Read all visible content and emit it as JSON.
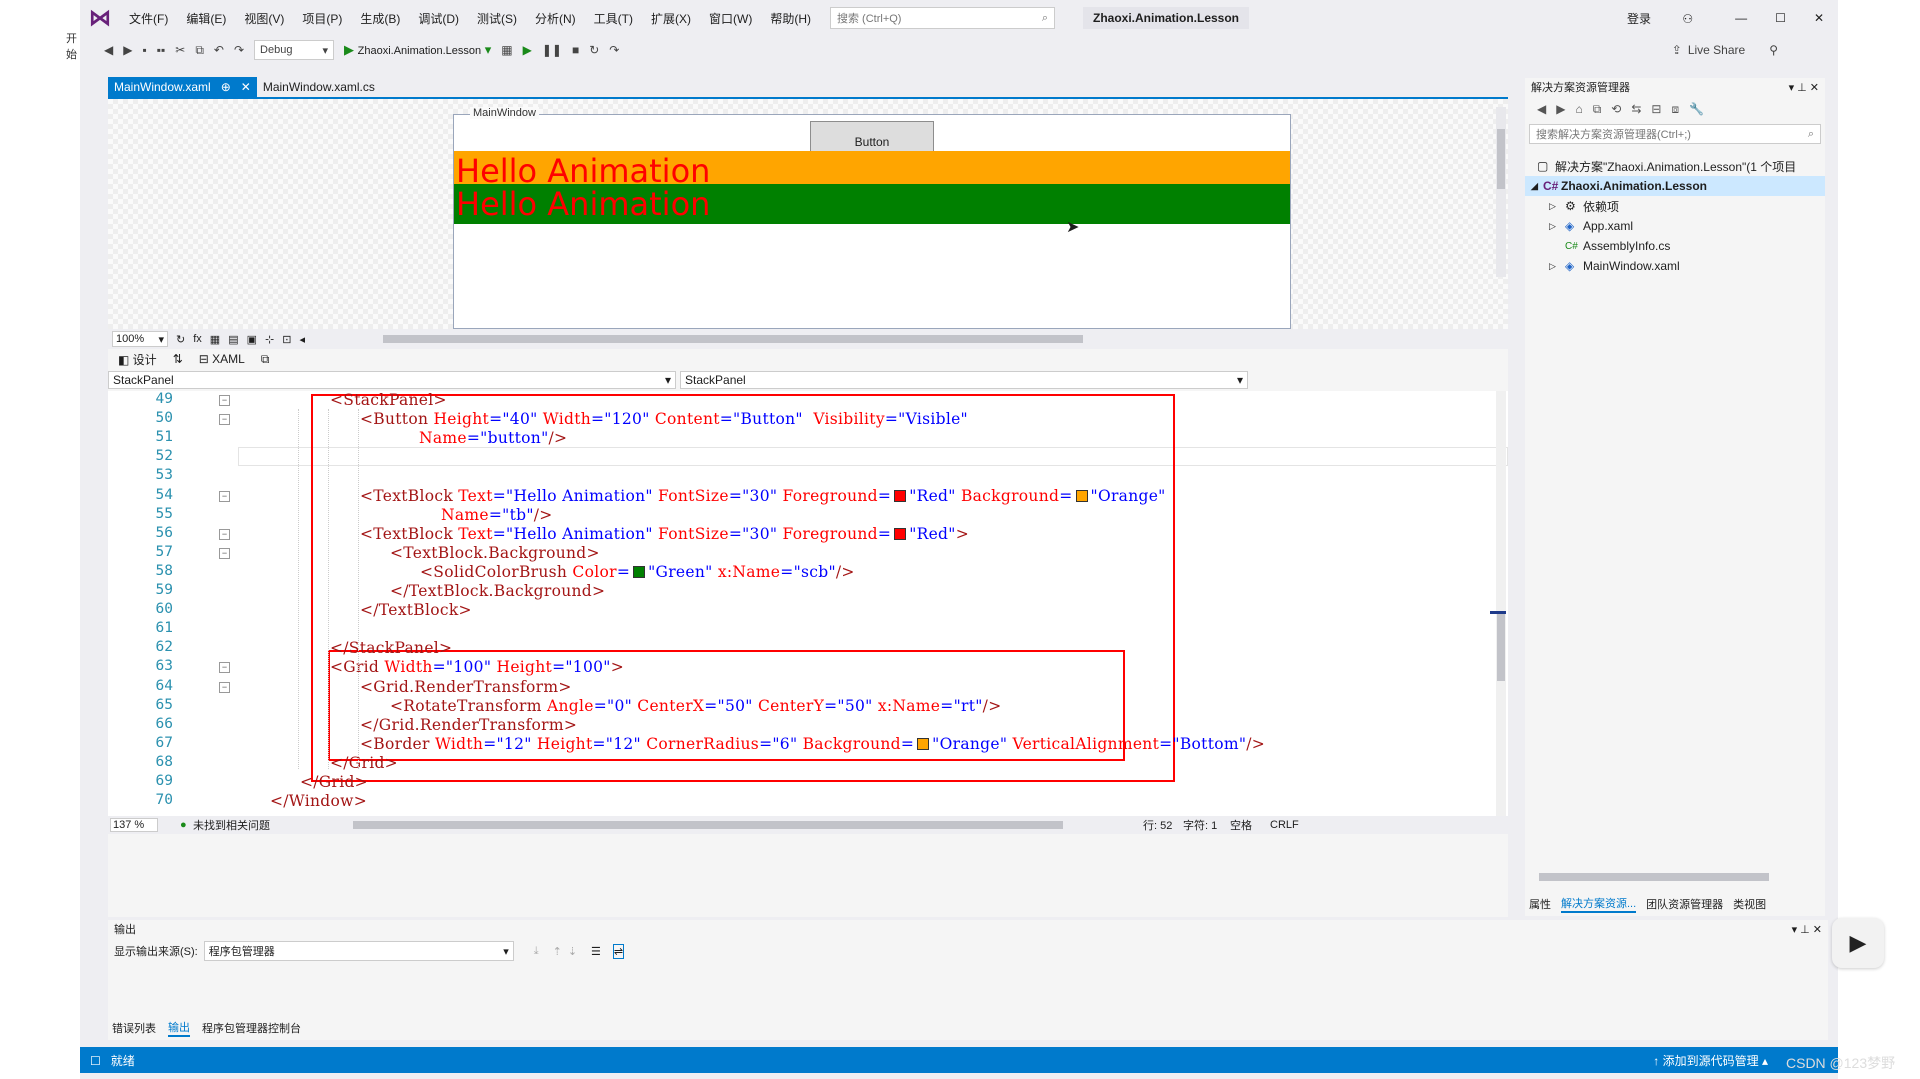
{
  "menu": {
    "items": [
      "文件(F)",
      "编辑(E)",
      "视图(V)",
      "项目(P)",
      "生成(B)",
      "调试(D)",
      "测试(S)",
      "分析(N)",
      "工具(T)",
      "扩展(X)",
      "窗口(W)",
      "帮助(H)"
    ],
    "search_placeholder": "搜索 (Ctrl+Q)",
    "solution_name": "Zhaoxi.Animation.Lesson",
    "login": "登录"
  },
  "left_strip_text": "开始",
  "toolbar": {
    "config": "Debug",
    "start_target": "Zhaoxi.Animation.Lesson",
    "live_share": "Live Share"
  },
  "tabs": [
    {
      "label": "MainWindow.xaml",
      "active": true
    },
    {
      "label": "MainWindow.xaml.cs",
      "active": false
    }
  ],
  "designer": {
    "window_title": "MainWindow",
    "button_label": "Button",
    "hello1": "Hello Animation",
    "hello2": "Hello Animation",
    "zoom": "100%",
    "design_tab": "设计",
    "xaml_tab": "XAML"
  },
  "colors": {
    "orange": "#ffa500",
    "green": "#008000",
    "red": "#ff0000",
    "accent": "#007acc"
  },
  "navbar": {
    "left": "StackPanel",
    "right": "StackPanel"
  },
  "code": {
    "line_numbers": [
      "49",
      "50",
      "51",
      "52",
      "53",
      "54",
      "55",
      "56",
      "57",
      "58",
      "59",
      "60",
      "61",
      "62",
      "63",
      "64",
      "65",
      "66",
      "67",
      "68",
      "69",
      "70"
    ],
    "lines": [
      {
        "indent": 62,
        "segments": [
          {
            "c": "t",
            "s": "<StackPanel>"
          }
        ]
      },
      {
        "indent": 92,
        "segments": [
          {
            "c": "t",
            "s": "<Button "
          },
          {
            "c": "a",
            "s": "Height"
          },
          {
            "c": "v",
            "s": "=\"40\" "
          },
          {
            "c": "a",
            "s": "Width"
          },
          {
            "c": "v",
            "s": "=\"120\" "
          },
          {
            "c": "a",
            "s": "Content"
          },
          {
            "c": "v",
            "s": "=\"Button\"  "
          },
          {
            "c": "a",
            "s": "Visibility"
          },
          {
            "c": "v",
            "s": "=\"Visible\""
          }
        ]
      },
      {
        "indent": 151,
        "segments": [
          {
            "c": "a",
            "s": "Name"
          },
          {
            "c": "v",
            "s": "=\"button\""
          },
          {
            "c": "t",
            "s": "/>"
          }
        ]
      },
      {
        "indent": 0,
        "segments": []
      },
      {
        "indent": 0,
        "segments": []
      },
      {
        "indent": 92,
        "segments": [
          {
            "c": "t",
            "s": "<TextBlock "
          },
          {
            "c": "a",
            "s": "Text"
          },
          {
            "c": "v",
            "s": "=\"Hello Animation\" "
          },
          {
            "c": "a",
            "s": "FontSize"
          },
          {
            "c": "v",
            "s": "=\"30\" "
          },
          {
            "c": "a",
            "s": "Foreground"
          },
          {
            "c": "v",
            "s": "="
          },
          {
            "sw": "#ff0000"
          },
          {
            "c": "v",
            "s": "\"Red\" "
          },
          {
            "c": "a",
            "s": "Background"
          },
          {
            "c": "v",
            "s": "="
          },
          {
            "sw": "#ffa500"
          },
          {
            "c": "v",
            "s": "\"Orange\""
          }
        ]
      },
      {
        "indent": 173,
        "segments": [
          {
            "c": "a",
            "s": "Name"
          },
          {
            "c": "v",
            "s": "=\"tb\""
          },
          {
            "c": "t",
            "s": "/>"
          }
        ]
      },
      {
        "indent": 92,
        "segments": [
          {
            "c": "t",
            "s": "<TextBlock "
          },
          {
            "c": "a",
            "s": "Text"
          },
          {
            "c": "v",
            "s": "=\"Hello Animation\" "
          },
          {
            "c": "a",
            "s": "FontSize"
          },
          {
            "c": "v",
            "s": "=\"30\" "
          },
          {
            "c": "a",
            "s": "Foreground"
          },
          {
            "c": "v",
            "s": "="
          },
          {
            "sw": "#ff0000"
          },
          {
            "c": "v",
            "s": "\"Red\""
          },
          {
            "c": "t",
            "s": ">"
          }
        ]
      },
      {
        "indent": 122,
        "segments": [
          {
            "c": "t",
            "s": "<TextBlock.Background>"
          }
        ]
      },
      {
        "indent": 152,
        "segments": [
          {
            "c": "t",
            "s": "<SolidColorBrush "
          },
          {
            "c": "a",
            "s": "Color"
          },
          {
            "c": "v",
            "s": "="
          },
          {
            "sw": "#008000"
          },
          {
            "c": "v",
            "s": "\"Green\" "
          },
          {
            "c": "a",
            "s": "x:Name"
          },
          {
            "c": "v",
            "s": "=\"scb\""
          },
          {
            "c": "t",
            "s": "/>"
          }
        ]
      },
      {
        "indent": 122,
        "segments": [
          {
            "c": "t",
            "s": "</TextBlock.Background>"
          }
        ]
      },
      {
        "indent": 92,
        "segments": [
          {
            "c": "t",
            "s": "</TextBlock>"
          }
        ]
      },
      {
        "indent": 0,
        "segments": []
      },
      {
        "indent": 62,
        "segments": [
          {
            "c": "t",
            "s": "</StackPanel>"
          }
        ]
      },
      {
        "indent": 62,
        "segments": [
          {
            "c": "t",
            "s": "<Grid "
          },
          {
            "c": "a",
            "s": "Width"
          },
          {
            "c": "v",
            "s": "=\"100\" "
          },
          {
            "c": "a",
            "s": "Height"
          },
          {
            "c": "v",
            "s": "=\"100\""
          },
          {
            "c": "t",
            "s": ">"
          }
        ]
      },
      {
        "indent": 92,
        "segments": [
          {
            "c": "t",
            "s": "<Grid.RenderTransform>"
          }
        ]
      },
      {
        "indent": 122,
        "segments": [
          {
            "c": "t",
            "s": "<RotateTransform "
          },
          {
            "c": "a",
            "s": "Angle"
          },
          {
            "c": "v",
            "s": "=\"0\" "
          },
          {
            "c": "a",
            "s": "CenterX"
          },
          {
            "c": "v",
            "s": "=\"50\" "
          },
          {
            "c": "a",
            "s": "CenterY"
          },
          {
            "c": "v",
            "s": "=\"50\" "
          },
          {
            "c": "a",
            "s": "x:Name"
          },
          {
            "c": "v",
            "s": "=\"rt\""
          },
          {
            "c": "t",
            "s": "/>"
          }
        ]
      },
      {
        "indent": 92,
        "segments": [
          {
            "c": "t",
            "s": "</Grid.RenderTransform>"
          }
        ]
      },
      {
        "indent": 92,
        "segments": [
          {
            "c": "t",
            "s": "<Border "
          },
          {
            "c": "a",
            "s": "Width"
          },
          {
            "c": "v",
            "s": "=\"12\" "
          },
          {
            "c": "a",
            "s": "Height"
          },
          {
            "c": "v",
            "s": "=\"12\" "
          },
          {
            "c": "a",
            "s": "CornerRadius"
          },
          {
            "c": "v",
            "s": "=\"6\" "
          },
          {
            "c": "a",
            "s": "Background"
          },
          {
            "c": "v",
            "s": "="
          },
          {
            "sw": "#ffa500"
          },
          {
            "c": "v",
            "s": "\"Orange\" "
          },
          {
            "c": "a",
            "s": "VerticalAlignment"
          },
          {
            "c": "v",
            "s": "=\"Bottom\""
          },
          {
            "c": "t",
            "s": "/>"
          }
        ]
      },
      {
        "indent": 62,
        "segments": [
          {
            "c": "t",
            "s": "</Grid>"
          }
        ]
      },
      {
        "indent": 32,
        "segments": [
          {
            "c": "t",
            "s": "</Grid>"
          }
        ]
      },
      {
        "indent": 2,
        "segments": [
          {
            "c": "t",
            "s": "</Window>"
          }
        ]
      }
    ]
  },
  "editor_status": {
    "zoom": "137 %",
    "issues": "未找到相关问题",
    "line": "行: 52",
    "col": "字符: 1",
    "spaces": "空格",
    "eol": "CRLF"
  },
  "solution_explorer": {
    "title": "解决方案资源管理器",
    "search_placeholder": "搜索解决方案资源管理器(Ctrl+;)",
    "tree": [
      {
        "label": "解决方案\"Zhaoxi.Animation.Lesson\"(1 个项目",
        "level": 0,
        "selected": false
      },
      {
        "label": "Zhaoxi.Animation.Lesson",
        "level": 1,
        "selected": true
      },
      {
        "label": "依赖项",
        "level": 2,
        "selected": false
      },
      {
        "label": "App.xaml",
        "level": 2,
        "selected": false
      },
      {
        "label": "AssemblyInfo.cs",
        "level": 2,
        "selected": false
      },
      {
        "label": "MainWindow.xaml",
        "level": 2,
        "selected": false
      }
    ],
    "tabs": [
      "属性",
      "解决方案资源...",
      "团队资源管理器",
      "类视图"
    ]
  },
  "output": {
    "title": "输出",
    "source_label": "显示输出来源(S):",
    "source_value": "程序包管理器"
  },
  "bottom_tabs": [
    "错误列表",
    "输出",
    "程序包管理器控制台"
  ],
  "statusbar": {
    "ready": "就绪",
    "source_control": "添加到源代码管理"
  },
  "watermark": "CSDN @123梦野"
}
